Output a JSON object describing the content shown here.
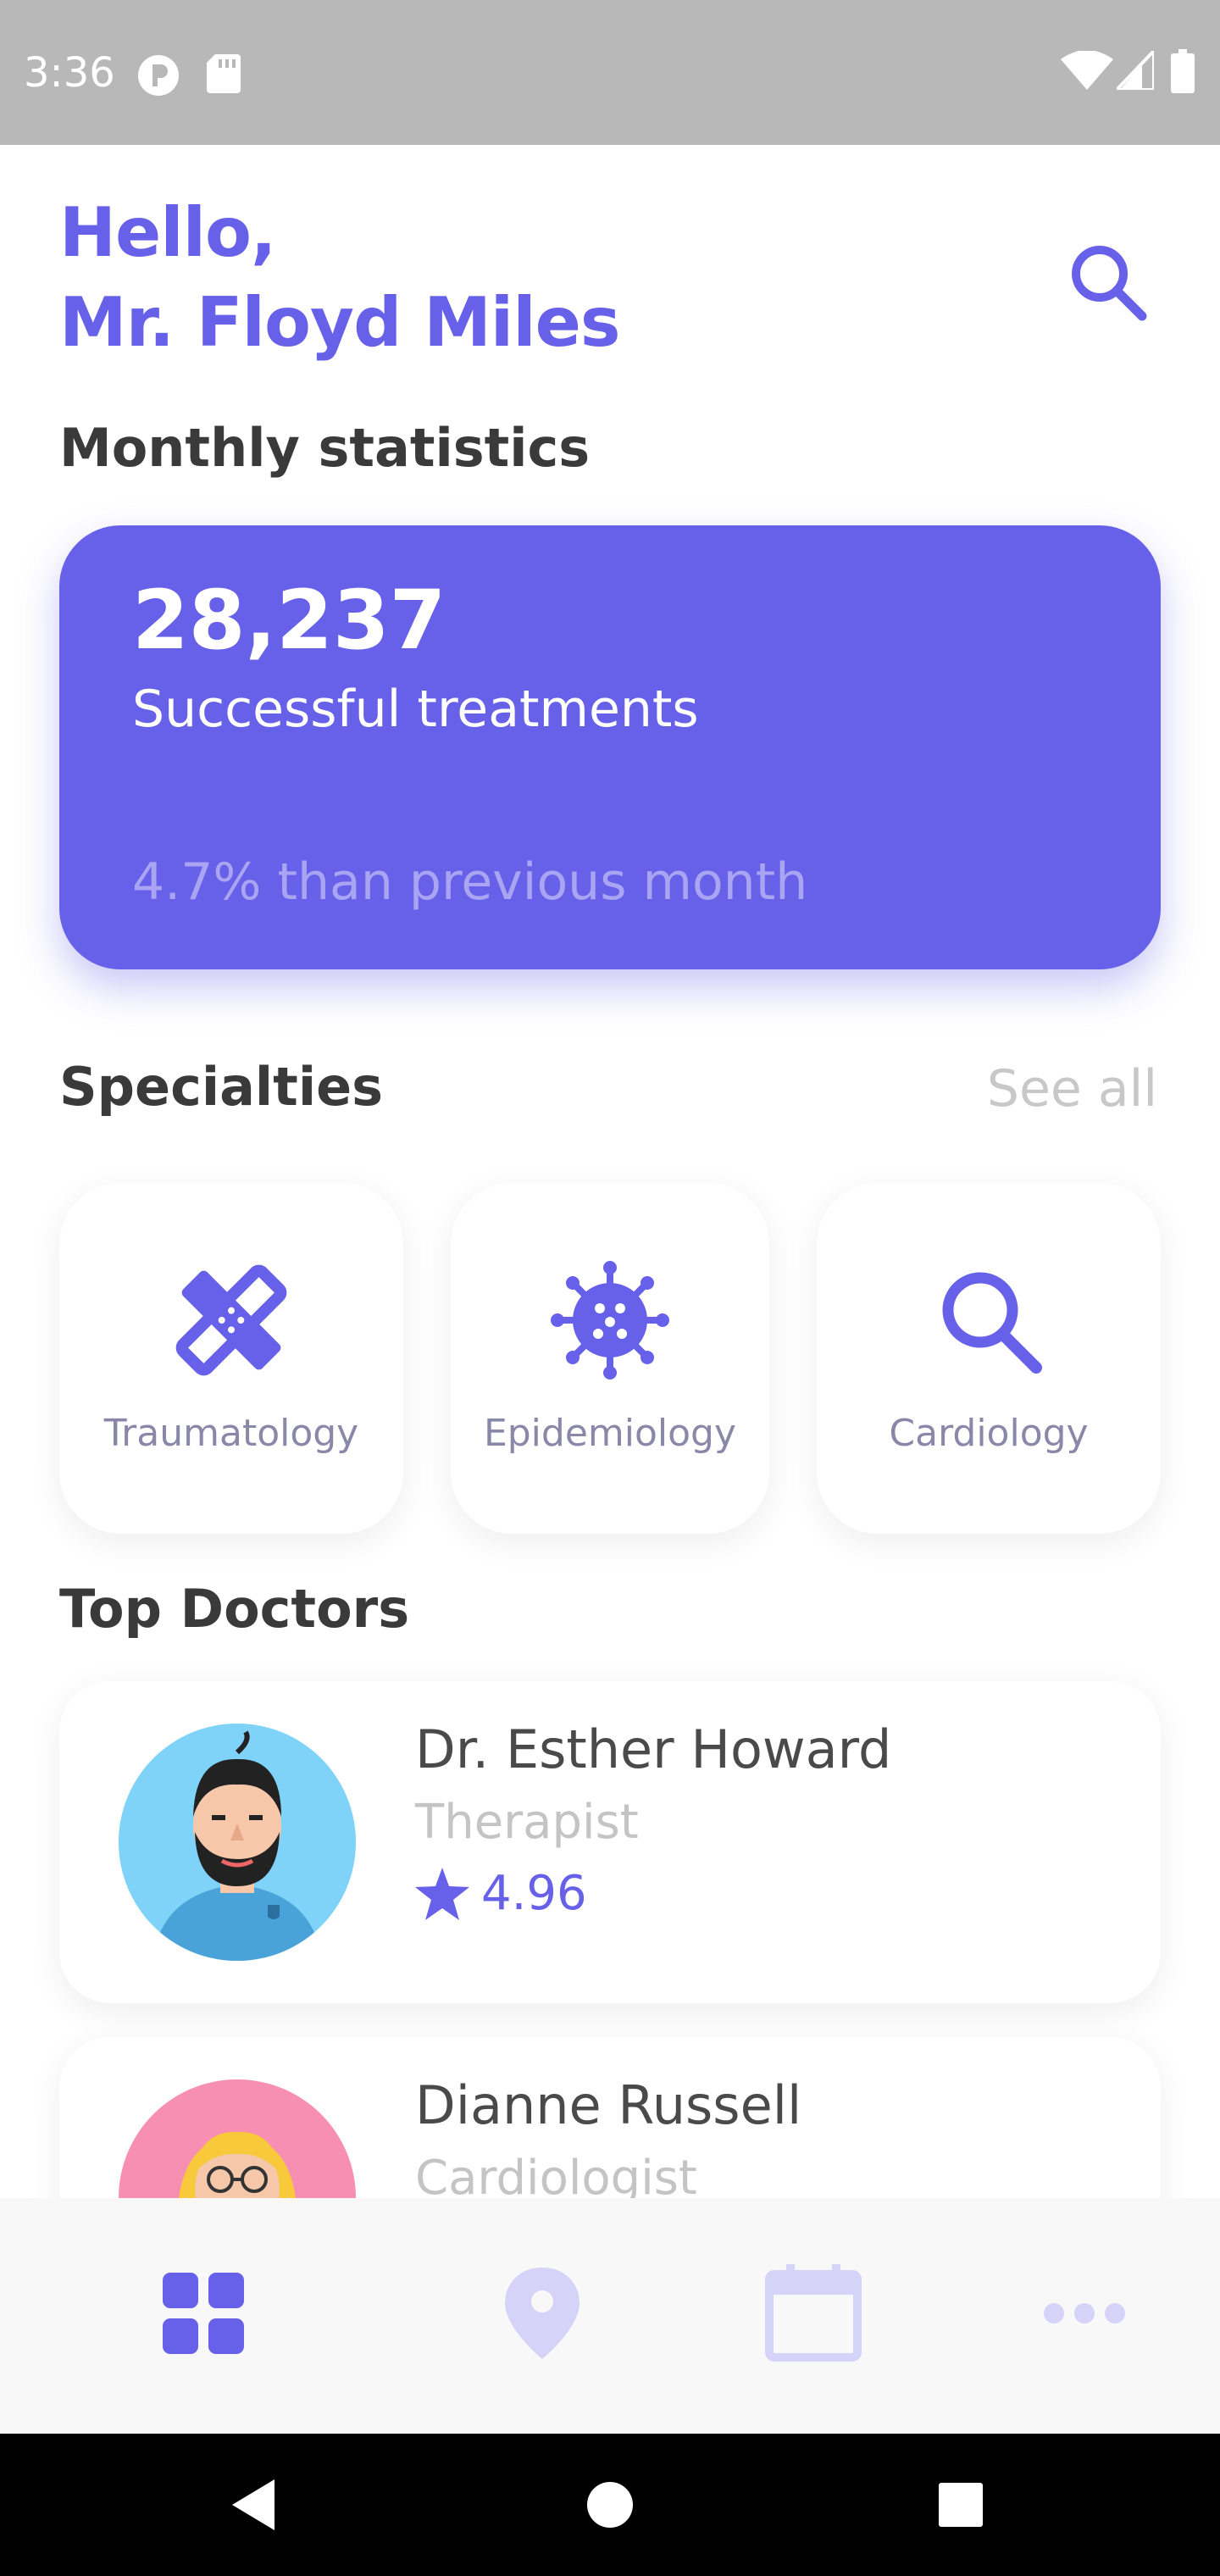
{
  "status_bar": {
    "time": "3:36",
    "icons": [
      "app-icon",
      "sd-card-icon",
      "wifi-icon",
      "signal-icon",
      "battery-icon"
    ]
  },
  "header": {
    "greeting_line1": "Hello,",
    "greeting_line2": "Mr. Floyd Miles",
    "search_icon": "search-icon"
  },
  "statistics": {
    "title": "Monthly statistics",
    "value": "28,237",
    "label": "Successful treatments",
    "change": "4.7% than previous month"
  },
  "specialties": {
    "title": "Specialties",
    "see_all": "See all",
    "items": [
      {
        "label": "Traumatology",
        "icon": "bandage-icon"
      },
      {
        "label": "Epidemiology",
        "icon": "virus-icon"
      },
      {
        "label": "Cardiology",
        "icon": "search-icon"
      }
    ]
  },
  "top_doctors": {
    "title": "Top Doctors",
    "items": [
      {
        "name": "Dr. Esther Howard",
        "specialty": "Therapist",
        "rating": "4.96"
      },
      {
        "name": "Dianne Russell",
        "specialty": "Cardiologist"
      }
    ]
  },
  "bottom_nav": {
    "items": [
      "dashboard-icon",
      "location-icon",
      "calendar-icon",
      "more-icon"
    ],
    "active": "dashboard-icon"
  },
  "colors": {
    "accent": "#6760e9",
    "accent_light": "#d6d3f9",
    "text_dark": "#3a3a3a",
    "text_muted": "#c4c4c4"
  }
}
